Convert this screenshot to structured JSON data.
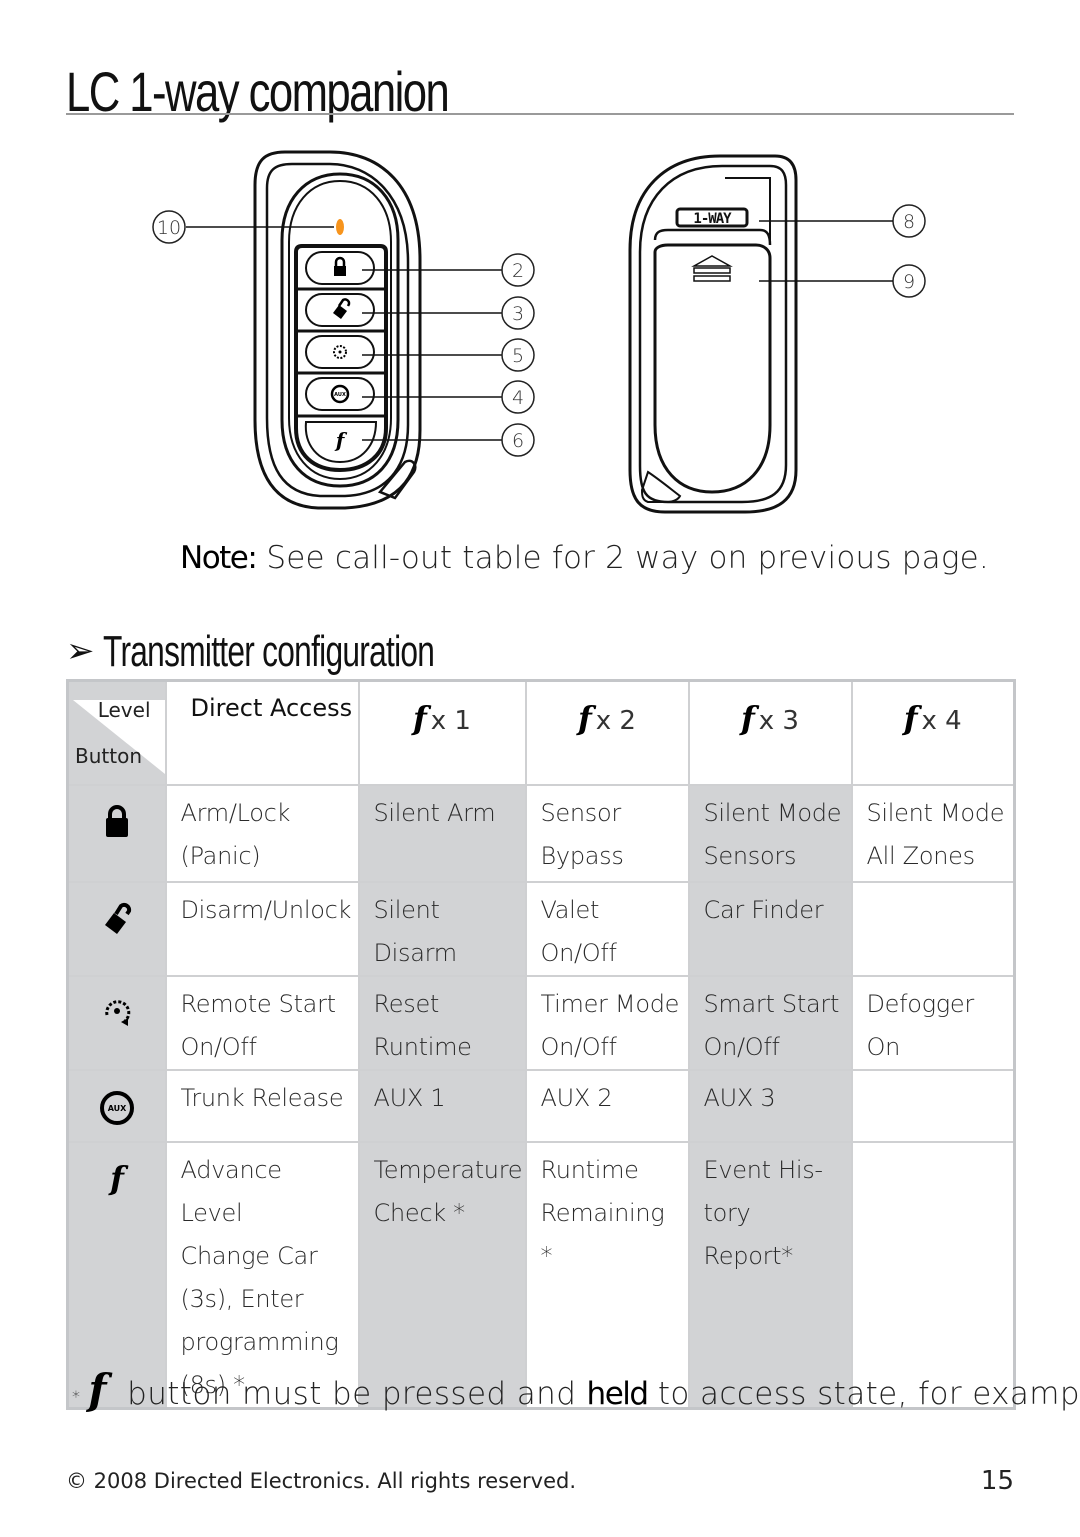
{
  "page": {
    "title": "LC 1-way companion",
    "note_label": "Note:",
    "note_text": " See call-out table for 2 way on previous page.",
    "section_arrow": "➢",
    "section_heading": "Transmitter configuration",
    "copyright": "© 2008 Directed Electronics. All rights reserved.",
    "page_number": "15"
  },
  "figure": {
    "led_color": "#f7941d",
    "front_callouts": [
      "10",
      "2",
      "3",
      "5",
      "4",
      "6"
    ],
    "back_callouts": [
      "8",
      "9"
    ],
    "badge_text": "1-WAY",
    "aux_label": "AUX"
  },
  "table": {
    "corner_level": "Level",
    "corner_button": "Button",
    "headers": [
      {
        "label": "Direct Access"
      },
      {
        "f": "f",
        "label": "x 1"
      },
      {
        "f": "f",
        "label": "x 2"
      },
      {
        "f": "f",
        "label": "x 3"
      },
      {
        "f": "f",
        "label": "x 4"
      }
    ],
    "rows": [
      {
        "button_icon": "lock-icon",
        "cells": [
          [
            "Arm/Lock",
            "(Panic)"
          ],
          [
            "Silent Arm"
          ],
          [
            "Sensor",
            "Bypass"
          ],
          [
            "Silent Mode",
            "Sensors"
          ],
          [
            "Silent Mode",
            "All Zones"
          ]
        ]
      },
      {
        "button_icon": "unlock-icon",
        "cells": [
          [
            "Disarm/Unlock"
          ],
          [
            "Silent Disarm"
          ],
          [
            "Valet",
            "On/Off"
          ],
          [
            "Car Finder"
          ],
          []
        ]
      },
      {
        "button_icon": "remote-start-icon",
        "cells": [
          [
            "Remote Start",
            "On/Off"
          ],
          [
            "Reset",
            "Runtime"
          ],
          [
            "Timer Mode",
            "On/Off"
          ],
          [
            "Smart Start",
            "On/Off"
          ],
          [
            "Defogger",
            "On"
          ]
        ]
      },
      {
        "button_icon": "aux-icon",
        "cells": [
          [
            "Trunk Release"
          ],
          [
            "AUX 1"
          ],
          [
            "AUX 2"
          ],
          [
            "AUX 3"
          ],
          []
        ]
      },
      {
        "button_icon": "function-icon",
        "cells": [
          [
            "Advance Level",
            "Change Car",
            "(3s), Enter",
            "programming",
            "(8s) *"
          ],
          [
            "Temperature",
            "Check  *"
          ],
          [
            "Runtime",
            "Remaining  *"
          ],
          [
            "Event His-",
            "tory Report*"
          ],
          []
        ]
      }
    ]
  },
  "footnote": {
    "star": "*",
    "f": "f",
    "before": " button must be pressed and ",
    "bold": "held",
    "after": " to access state, for example to"
  }
}
